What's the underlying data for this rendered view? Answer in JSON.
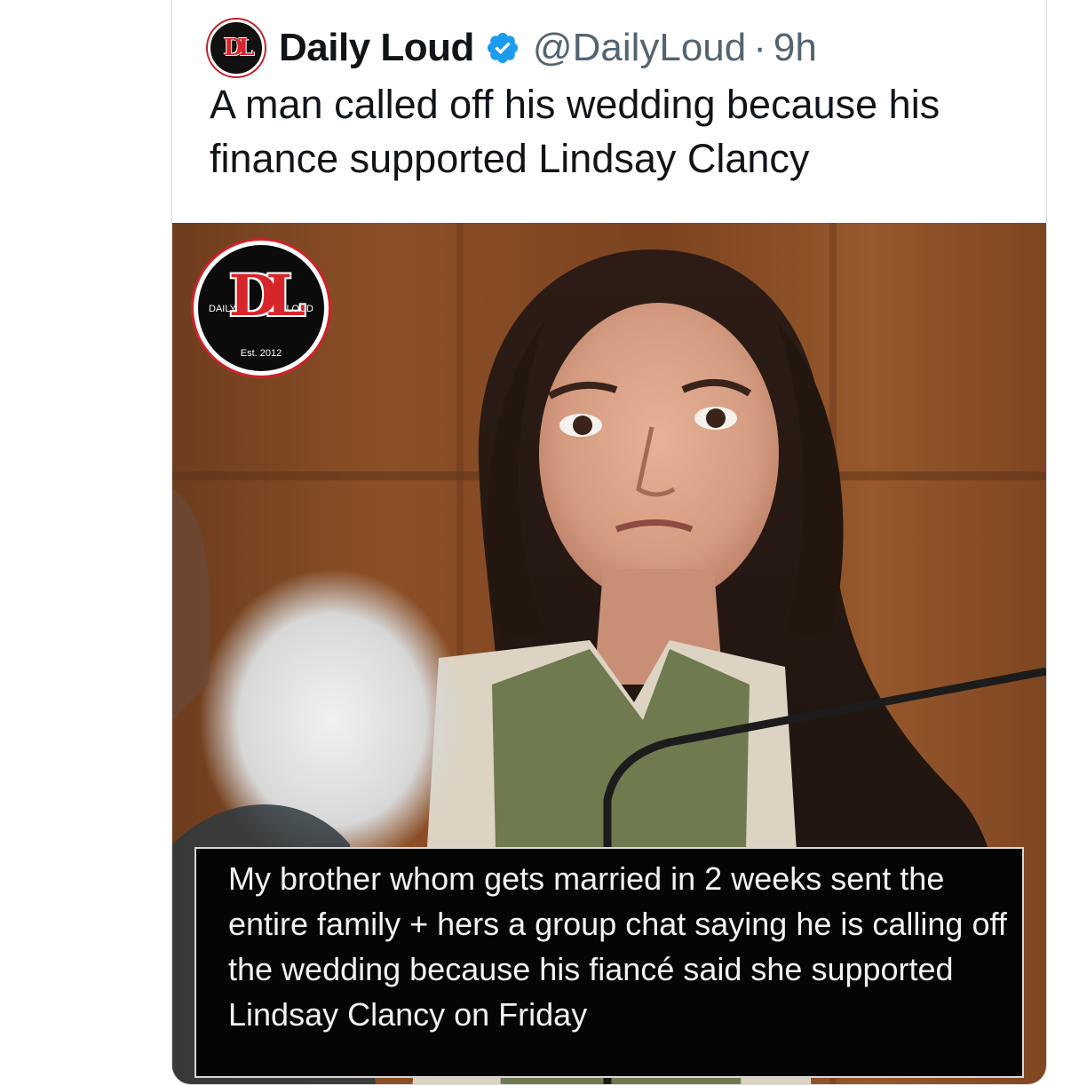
{
  "tweet": {
    "display_name": "Daily Loud",
    "handle": "@DailyLoud",
    "separator": "·",
    "time": "9h",
    "text": "A man called off his wedding because his finance supported Lindsay Clancy",
    "verified_color": "#1d9bf0"
  },
  "media": {
    "logo": {
      "mark": "DL",
      "left_word": "DAILY",
      "right_word": "LOUD",
      "est": "Est. 2012"
    },
    "caption": "My brother whom gets married in 2 weeks sent the entire family + hers a group chat saying he is calling off the wedding because his fiancé said she supported Lindsay Clancy on Friday"
  },
  "icons": {
    "avatar": "daily-loud-logo",
    "verified": "verified-badge-icon"
  }
}
